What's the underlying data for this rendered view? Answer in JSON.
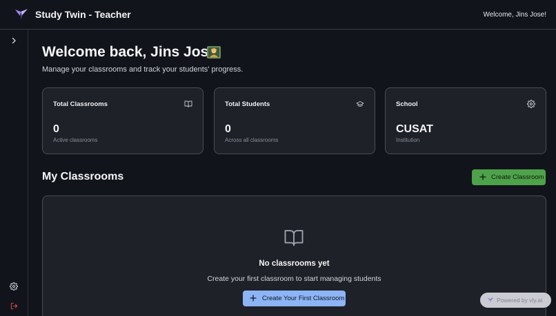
{
  "header": {
    "app_title": "Study Twin - Teacher",
    "welcome": "Welcome, Jins Jose!"
  },
  "main": {
    "title": "Welcome back, Jins Jose!",
    "subtitle": "Manage your classrooms and track your students' progress.",
    "stats": [
      {
        "label": "Total Classrooms",
        "value": "0",
        "sub": "Active classrooms",
        "icon": "book-icon"
      },
      {
        "label": "Total Students",
        "value": "0",
        "sub": "Across all classrooms",
        "icon": "graduation-cap-icon"
      },
      {
        "label": "School",
        "value": "CUSAT",
        "sub": "Institution",
        "icon": "gear-icon"
      }
    ],
    "section_title": "My Classrooms",
    "create_label": "Create Classroom",
    "empty": {
      "title": "No classrooms yet",
      "description": "Create your first classroom to start managing students",
      "button_label": "Create Your First Classroom"
    }
  },
  "powered_by": "Powered by vly.ai",
  "colors": {
    "background": "#12141b",
    "card": "#1f2128",
    "primary_green": "#4ea24a",
    "primary_blue": "#8db4f5",
    "brand_purple": "#8b6cf0",
    "logout_red": "#e5484d"
  }
}
